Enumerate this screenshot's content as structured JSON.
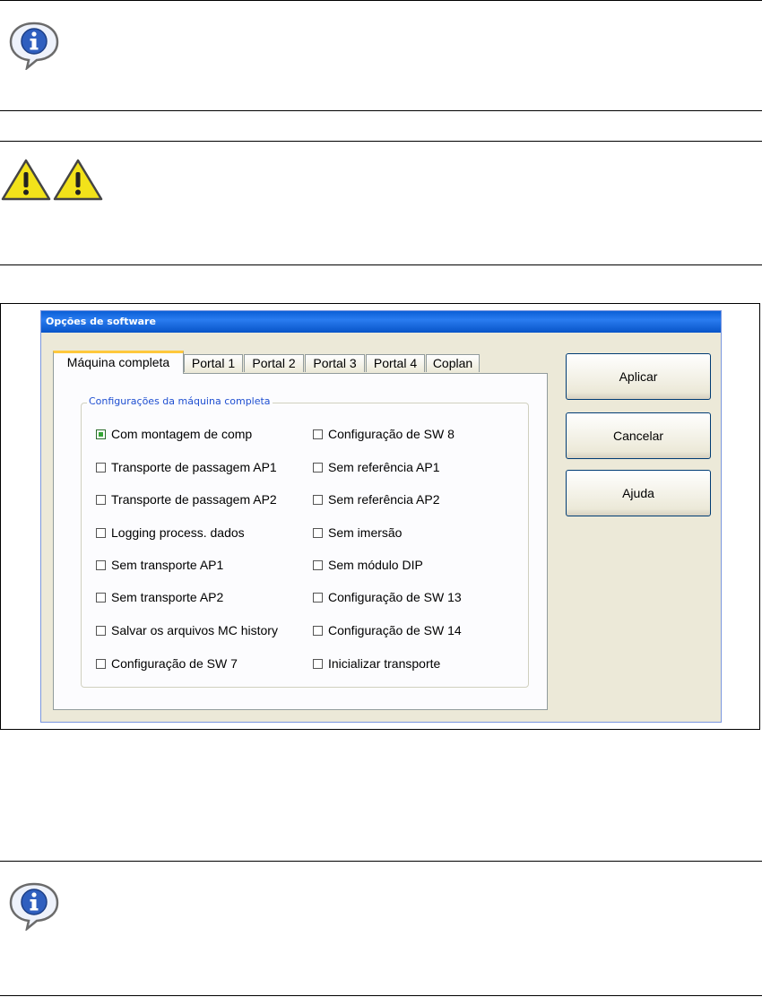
{
  "dialog": {
    "title": "Opções de software",
    "tabs": [
      "Máquina completa",
      "Portal 1",
      "Portal 2",
      "Portal 3",
      "Portal 4",
      "Coplan"
    ],
    "active_tab": "Máquina completa",
    "group_title": "Configurações da máquina completa",
    "left_options": [
      {
        "label": "Com montagem de comp",
        "checked": true
      },
      {
        "label": "Transporte de passagem AP1",
        "checked": false
      },
      {
        "label": "Transporte de passagem AP2",
        "checked": false
      },
      {
        "label": "Logging process. dados",
        "checked": false
      },
      {
        "label": "Sem transporte AP1",
        "checked": false
      },
      {
        "label": "Sem transporte AP2",
        "checked": false
      },
      {
        "label": "Salvar os arquivos MC history",
        "checked": false
      },
      {
        "label": "Configuração de SW 7",
        "checked": false
      }
    ],
    "right_options": [
      {
        "label": "Configuração de SW 8",
        "checked": false
      },
      {
        "label": "Sem referência AP1",
        "checked": false
      },
      {
        "label": "Sem referência AP2",
        "checked": false
      },
      {
        "label": "Sem imersão",
        "checked": false
      },
      {
        "label": "Sem módulo DIP",
        "checked": false
      },
      {
        "label": "Configuração de SW 13",
        "checked": false
      },
      {
        "label": "Configuração de SW 14",
        "checked": false
      },
      {
        "label": "Inicializar transporte",
        "checked": false
      }
    ],
    "buttons": {
      "apply": "Aplicar",
      "cancel": "Cancelar",
      "help": "Ajuda"
    }
  },
  "icons": {
    "info": "info-speech-bubble-icon",
    "warning": "warning-triangle-icon"
  },
  "colors": {
    "titlebar": "#0a5fd6",
    "tab_accent": "#ffc83c",
    "group_legend": "#1f4fd1",
    "checked": "#35a535"
  }
}
